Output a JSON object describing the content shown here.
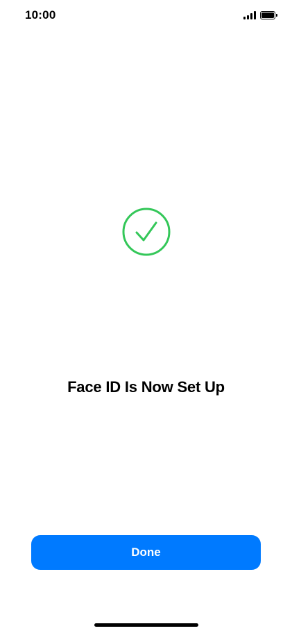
{
  "status_bar": {
    "time": "10:00",
    "signal_icon": "cellular-signal-icon",
    "battery_icon": "battery-full-icon"
  },
  "main": {
    "status_icon": "checkmark-circle-icon",
    "title": "Face ID Is Now Set Up"
  },
  "actions": {
    "done_label": "Done"
  },
  "colors": {
    "success_green": "#34c759",
    "accent_blue": "#007aff"
  }
}
